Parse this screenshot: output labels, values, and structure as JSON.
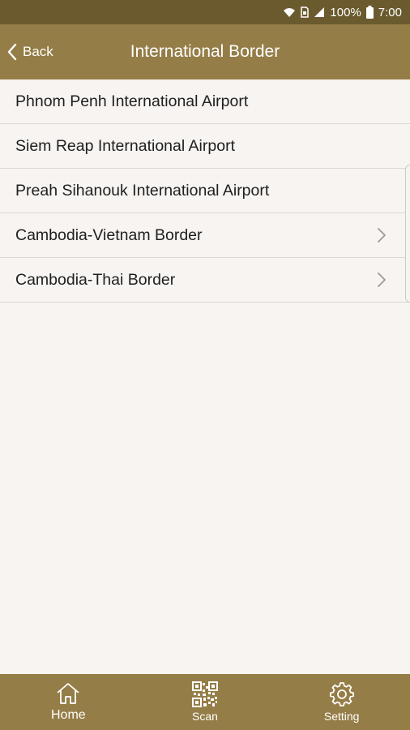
{
  "status_bar": {
    "battery": "100%",
    "time": "7:00",
    "icons": [
      "wifi-icon",
      "sim-icon",
      "signal-icon",
      "battery-icon"
    ]
  },
  "header": {
    "back_label": "Back",
    "title": "International Border"
  },
  "list": {
    "items": [
      {
        "label": "Phnom Penh International Airport",
        "has_chevron": false
      },
      {
        "label": "Siem Reap International Airport",
        "has_chevron": false
      },
      {
        "label": "Preah Sihanouk International Airport",
        "has_chevron": false
      },
      {
        "label": "Cambodia-Vietnam Border",
        "has_chevron": true
      },
      {
        "label": "Cambodia-Thai Border",
        "has_chevron": true
      }
    ]
  },
  "bottom_nav": {
    "items": [
      {
        "label": "Home",
        "icon": "home-icon"
      },
      {
        "label": "Scan",
        "icon": "qr-code-icon"
      },
      {
        "label": "Setting",
        "icon": "gear-icon"
      }
    ]
  },
  "colors": {
    "status_bar": "#6a5a2e",
    "header": "#957d47",
    "background": "#f7f4f2",
    "divider": "#dcd8d3"
  }
}
